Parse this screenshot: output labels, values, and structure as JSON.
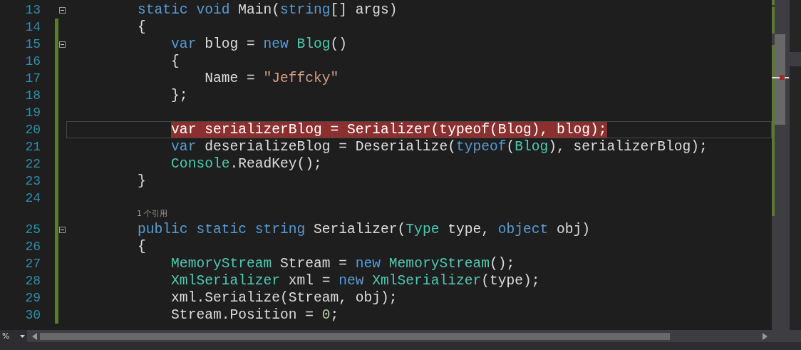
{
  "editor": {
    "lines": [
      {
        "number": "13",
        "fold": true,
        "changed": false,
        "current": false,
        "breakpoint": false,
        "tokens": [
          {
            "text": "        static void",
            "kind": "keyword"
          },
          {
            "text": " Main(",
            "kind": "plain"
          },
          {
            "text": "string",
            "kind": "keyword"
          },
          {
            "text": "[] args)",
            "kind": "plain"
          }
        ]
      },
      {
        "number": "14",
        "fold": false,
        "changed": true,
        "current": false,
        "breakpoint": false,
        "tokens": [
          {
            "text": "        {",
            "kind": "plain"
          }
        ]
      },
      {
        "number": "15",
        "fold": true,
        "changed": true,
        "current": false,
        "breakpoint": false,
        "tokens": [
          {
            "text": "            var",
            "kind": "keyword"
          },
          {
            "text": " blog = ",
            "kind": "plain"
          },
          {
            "text": "new",
            "kind": "keyword"
          },
          {
            "text": " Blog",
            "kind": "type"
          },
          {
            "text": "()",
            "kind": "plain"
          }
        ]
      },
      {
        "number": "16",
        "fold": false,
        "changed": true,
        "current": false,
        "breakpoint": false,
        "tokens": [
          {
            "text": "            {",
            "kind": "plain"
          }
        ]
      },
      {
        "number": "17",
        "fold": false,
        "changed": true,
        "current": false,
        "breakpoint": false,
        "tokens": [
          {
            "text": "                Name = ",
            "kind": "plain"
          },
          {
            "text": "\"Jeffcky\"",
            "kind": "string"
          }
        ]
      },
      {
        "number": "18",
        "fold": false,
        "changed": true,
        "current": false,
        "breakpoint": false,
        "tokens": [
          {
            "text": "            };",
            "kind": "plain"
          }
        ]
      },
      {
        "number": "19",
        "fold": false,
        "changed": true,
        "current": false,
        "breakpoint": false
      },
      {
        "number": "20",
        "fold": false,
        "changed": true,
        "current": true,
        "breakpoint": true,
        "tokens": [
          {
            "text": "            var serializerBlog = Serializer(typeof(Blog), blog);",
            "kind": "plain"
          }
        ]
      },
      {
        "number": "21",
        "fold": false,
        "changed": true,
        "current": false,
        "breakpoint": false,
        "tokens": [
          {
            "text": "            var",
            "kind": "keyword"
          },
          {
            "text": " deserializeBlog = Deserialize(",
            "kind": "plain"
          },
          {
            "text": "typeof",
            "kind": "keyword"
          },
          {
            "text": "(",
            "kind": "plain"
          },
          {
            "text": "Blog",
            "kind": "type"
          },
          {
            "text": "), serializerBlog);",
            "kind": "plain"
          }
        ]
      },
      {
        "number": "22",
        "fold": false,
        "changed": true,
        "current": false,
        "breakpoint": false,
        "tokens": [
          {
            "text": "            Console",
            "kind": "type"
          },
          {
            "text": ".ReadKey();",
            "kind": "plain"
          }
        ]
      },
      {
        "number": "23",
        "fold": false,
        "changed": true,
        "current": false,
        "breakpoint": false,
        "tokens": [
          {
            "text": "        }",
            "kind": "plain"
          }
        ]
      },
      {
        "number": "24",
        "fold": false,
        "changed": true,
        "current": false,
        "breakpoint": false
      },
      {
        "number": "25",
        "lens": "1 个引用",
        "fold": true,
        "changed": true,
        "current": false,
        "breakpoint": false,
        "tokens": [
          {
            "text": "        public static string",
            "kind": "keyword"
          },
          {
            "text": " Serializer(",
            "kind": "plain"
          },
          {
            "text": "Type",
            "kind": "type"
          },
          {
            "text": " type, ",
            "kind": "plain"
          },
          {
            "text": "object",
            "kind": "keyword"
          },
          {
            "text": " obj)",
            "kind": "plain"
          }
        ]
      },
      {
        "number": "26",
        "fold": false,
        "changed": true,
        "current": false,
        "breakpoint": false,
        "tokens": [
          {
            "text": "        {",
            "kind": "plain"
          }
        ]
      },
      {
        "number": "27",
        "fold": false,
        "changed": true,
        "current": false,
        "breakpoint": false,
        "tokens": [
          {
            "text": "            MemoryStream",
            "kind": "type"
          },
          {
            "text": " Stream = ",
            "kind": "plain"
          },
          {
            "text": "new",
            "kind": "keyword"
          },
          {
            "text": " MemoryStream",
            "kind": "type"
          },
          {
            "text": "();",
            "kind": "plain"
          }
        ]
      },
      {
        "number": "28",
        "fold": false,
        "changed": true,
        "current": false,
        "breakpoint": false,
        "tokens": [
          {
            "text": "            XmlSerializer",
            "kind": "type"
          },
          {
            "text": " xml = ",
            "kind": "plain"
          },
          {
            "text": "new",
            "kind": "keyword"
          },
          {
            "text": " XmlSerializer",
            "kind": "type"
          },
          {
            "text": "(type);",
            "kind": "plain"
          }
        ]
      },
      {
        "number": "29",
        "fold": false,
        "changed": true,
        "current": false,
        "breakpoint": false,
        "tokens": [
          {
            "text": "            xml.Serialize(Stream, obj);",
            "kind": "plain"
          }
        ]
      },
      {
        "number": "30",
        "fold": false,
        "changed": true,
        "current": false,
        "breakpoint": false,
        "tokens": [
          {
            "text": "            Stream.Position = ",
            "kind": "plain"
          },
          {
            "text": "0",
            "kind": "number"
          },
          {
            "text": ";",
            "kind": "plain"
          }
        ]
      }
    ]
  },
  "status_bar": {
    "zoom": "%"
  }
}
